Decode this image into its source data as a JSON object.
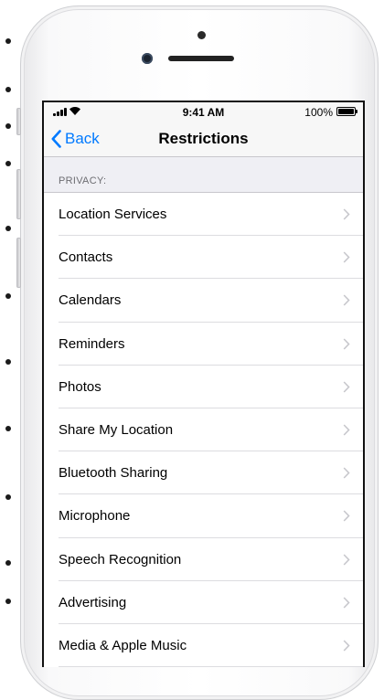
{
  "status_bar": {
    "time": "9:41 AM",
    "battery": "100%"
  },
  "nav": {
    "back_label": "Back",
    "title": "Restrictions"
  },
  "section": {
    "header": "PRIVACY:"
  },
  "items": [
    {
      "label": "Location Services"
    },
    {
      "label": "Contacts"
    },
    {
      "label": "Calendars"
    },
    {
      "label": "Reminders"
    },
    {
      "label": "Photos"
    },
    {
      "label": "Share My Location"
    },
    {
      "label": "Bluetooth Sharing"
    },
    {
      "label": "Microphone"
    },
    {
      "label": "Speech Recognition"
    },
    {
      "label": "Advertising"
    },
    {
      "label": "Media & Apple Music"
    }
  ],
  "colors": {
    "accent": "#007aff",
    "background": "#efeff4",
    "separator": "#c8c7cc",
    "chevron": "#c7c7cc"
  },
  "icons": [
    "signal-bars-icon",
    "wifi-icon",
    "battery-icon",
    "chevron-left-icon",
    "chevron-right-icon"
  ]
}
